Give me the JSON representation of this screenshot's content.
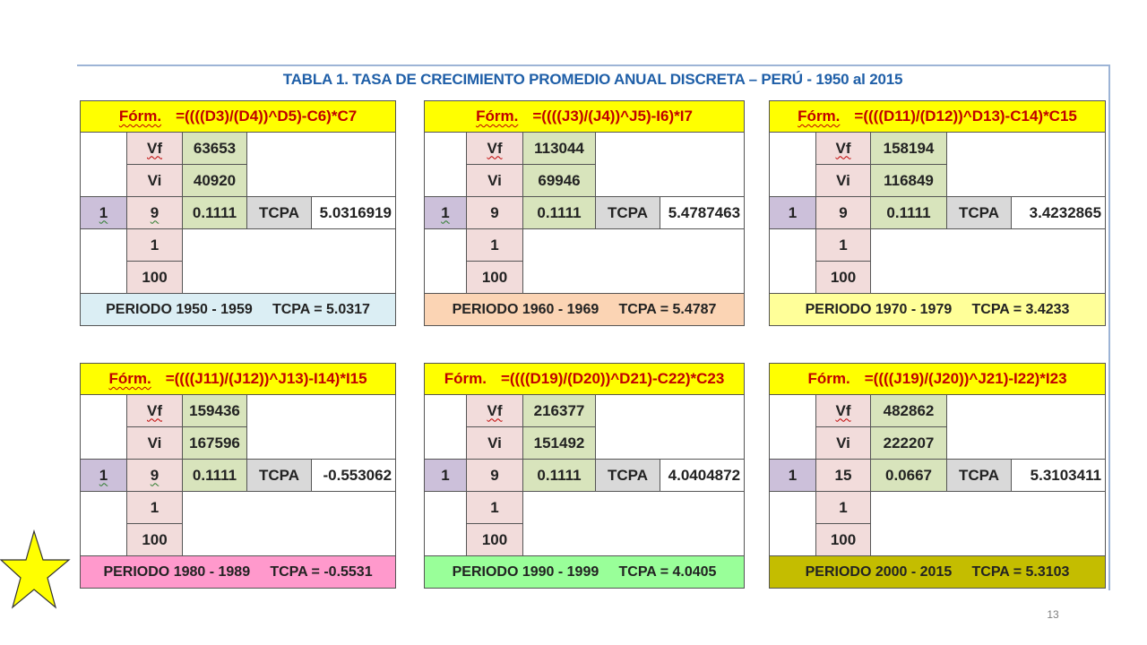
{
  "title": "TABLA 1.  TASA DE CRECIMIENTO PROMEDIO ANUAL DISCRETA – PERÚ -  1950  al  2015",
  "page_number": "13",
  "labels": {
    "form": "Fórm.",
    "vf": "Vf",
    "vi": "Vi",
    "tcpa": "TCPA"
  },
  "tables": [
    {
      "formula": "=((((D3)/(D4))^D5)-C6)*C7",
      "vf": "63653",
      "vi": "40920",
      "n": "1",
      "years": "9",
      "exp": "0.1111",
      "tcpa": "5.0316919",
      "one": "1",
      "hundred": "100",
      "period": "PERIODO 1950 - 1959",
      "period_tcpa": "TCPA = 5.0317",
      "period_color": "#dbeef4"
    },
    {
      "formula": "=((((J3)/(J4))^J5)-I6)*I7",
      "vf": "113044",
      "vi": "69946",
      "n": "1",
      "years": "9",
      "exp": "0.1111",
      "tcpa": "5.4787463",
      "one": "1",
      "hundred": "100",
      "period": "PERIODO 1960 - 1969",
      "period_tcpa": "TCPA = 5.4787",
      "period_color": "#fbd4b4"
    },
    {
      "formula": "=((((D11)/(D12))^D13)-C14)*C15",
      "vf": "158194",
      "vi": "116849",
      "n": "1",
      "years": "9",
      "exp": "0.1111",
      "tcpa": "3.4232865",
      "one": "1",
      "hundred": "100",
      "period": "PERIODO 1970 - 1979",
      "period_tcpa": "TCPA = 3.4233",
      "period_color": "#ffff99"
    },
    {
      "formula": "=((((J11)/(J12))^J13)-I14)*I15",
      "vf": "159436",
      "vi": "167596",
      "n": "1",
      "years": "9",
      "exp": "0.1111",
      "tcpa": "-0.553062",
      "one": "1",
      "hundred": "100",
      "period": "PERIODO 1980 - 1989",
      "period_tcpa": "TCPA =  -0.5531",
      "period_color": "#ff99cc"
    },
    {
      "formula": "=((((D19)/(D20))^D21)-C22)*C23",
      "vf": "216377",
      "vi": "151492",
      "n": "1",
      "years": "9",
      "exp": "0.1111",
      "tcpa": "4.0404872",
      "one": "1",
      "hundred": "100",
      "period": "PERIODO 1990 - 1999",
      "period_tcpa": "TCPA =  4.0405",
      "period_color": "#99ff99"
    },
    {
      "formula": "=((((J19)/(J20))^J21)-I22)*I23",
      "vf": "482862",
      "vi": "222207",
      "n": "1",
      "years": "15",
      "exp": "0.0667",
      "tcpa": "5.3103411",
      "one": "1",
      "hundred": "100",
      "period": "PERIODO 2000 - 2015",
      "period_tcpa": "TCPA =  5.3103",
      "period_color": "#c4bd00"
    }
  ],
  "colors": {
    "title": "#1f5fa8",
    "formula_bg": "#ffff00",
    "formula_text": "#c00000",
    "star": "#ffff00"
  },
  "decorations": {
    "star_icon": "star-icon"
  }
}
